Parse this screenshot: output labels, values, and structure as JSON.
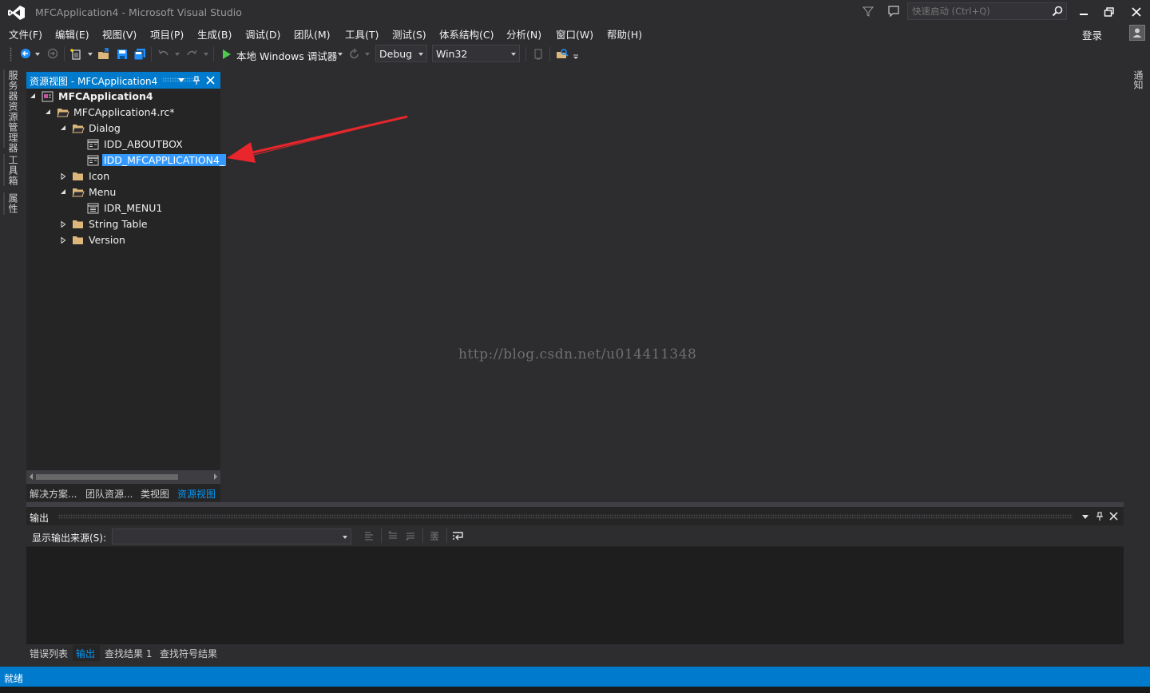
{
  "window": {
    "title": "MFCApplication4 - Microsoft Visual Studio",
    "quick_launch_placeholder": "快速启动 (Ctrl+Q)",
    "sign_in": "登录"
  },
  "menu": [
    "文件(F)",
    "编辑(E)",
    "视图(V)",
    "项目(P)",
    "生成(B)",
    "调试(D)",
    "团队(M)",
    "工具(T)",
    "测试(S)",
    "体系结构(C)",
    "分析(N)",
    "窗口(W)",
    "帮助(H)"
  ],
  "toolbar": {
    "run_label": "本地 Windows 调试器",
    "configuration": "Debug",
    "platform": "Win32"
  },
  "left_strip_tabs": [
    "服务器资源管理器",
    "工具箱",
    "属性"
  ],
  "right_strip_tab": "通知",
  "resource_view": {
    "title": "资源视图 - MFCApplication4",
    "tree": [
      {
        "label": "MFCApplication4",
        "bold": true
      },
      {
        "label": "MFCApplication4.rc*"
      },
      {
        "label": "Dialog"
      },
      {
        "label": "IDD_ABOUTBOX"
      },
      {
        "label": "IDD_MFCAPPLICATION4_",
        "selected": true
      },
      {
        "label": "Icon"
      },
      {
        "label": "Menu"
      },
      {
        "label": "IDR_MENU1"
      },
      {
        "label": "String Table"
      },
      {
        "label": "Version"
      }
    ],
    "tabs": [
      "解决方案...",
      "团队资源...",
      "类视图",
      "资源视图"
    ],
    "active_tab": "资源视图"
  },
  "watermark": "http://blog.csdn.net/u014411348",
  "output": {
    "title": "输出",
    "source_label": "显示输出来源(S):",
    "source_value": "",
    "tabs": [
      "错误列表",
      "输出",
      "查找结果 1",
      "查找符号结果"
    ],
    "active_tab": "输出"
  },
  "status": "就绪",
  "colors": {
    "accent": "#007acc",
    "background": "#2d2d30",
    "selection": "#3399ff",
    "arrow": "#e8262b",
    "folder": "#dcb67a"
  }
}
